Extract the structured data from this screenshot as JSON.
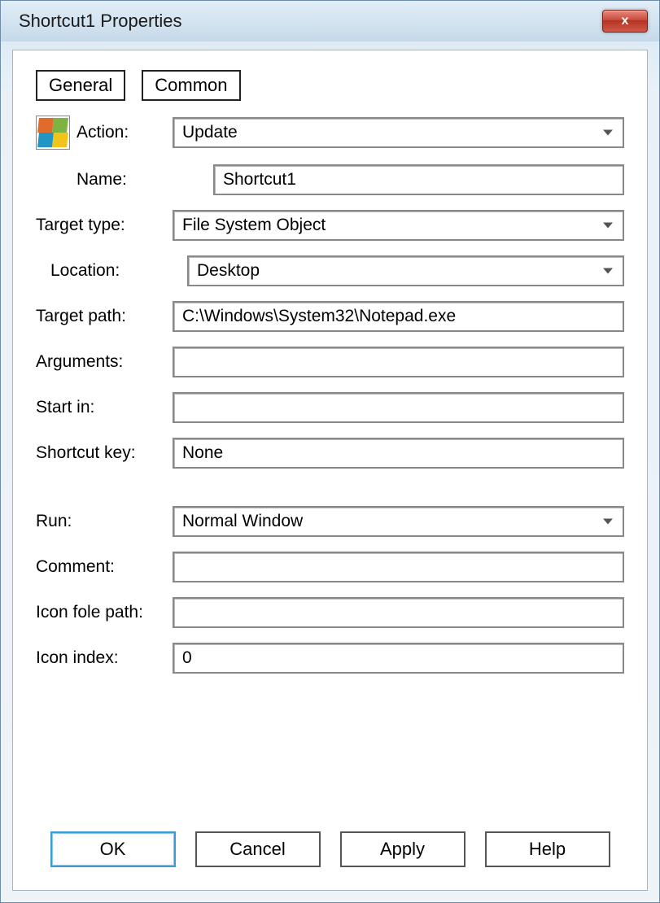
{
  "title": "Shortcut1 Properties",
  "tabs": {
    "general": "General",
    "common": "Common"
  },
  "labels": {
    "action": "Action:",
    "name": "Name:",
    "target_type": "Target type:",
    "location": "Location:",
    "target_path": "Target path:",
    "arguments": "Arguments:",
    "start_in": "Start in:",
    "shortcut_key": "Shortcut key:",
    "run": "Run:",
    "comment": "Comment:",
    "icon_file_path": "Icon fole path:",
    "icon_index": "Icon index:"
  },
  "values": {
    "action": "Update",
    "name": "Shortcut1",
    "target_type": "File System Object",
    "location": "Desktop",
    "target_path": "C:\\Windows\\System32\\Notepad.exe",
    "arguments": "",
    "start_in": "",
    "shortcut_key": "None",
    "run": "Normal Window",
    "comment": "",
    "icon_file_path": "",
    "icon_index": "0"
  },
  "buttons": {
    "ok": "OK",
    "cancel": "Cancel",
    "apply": "Apply",
    "help": "Help"
  },
  "close_glyph": "x"
}
